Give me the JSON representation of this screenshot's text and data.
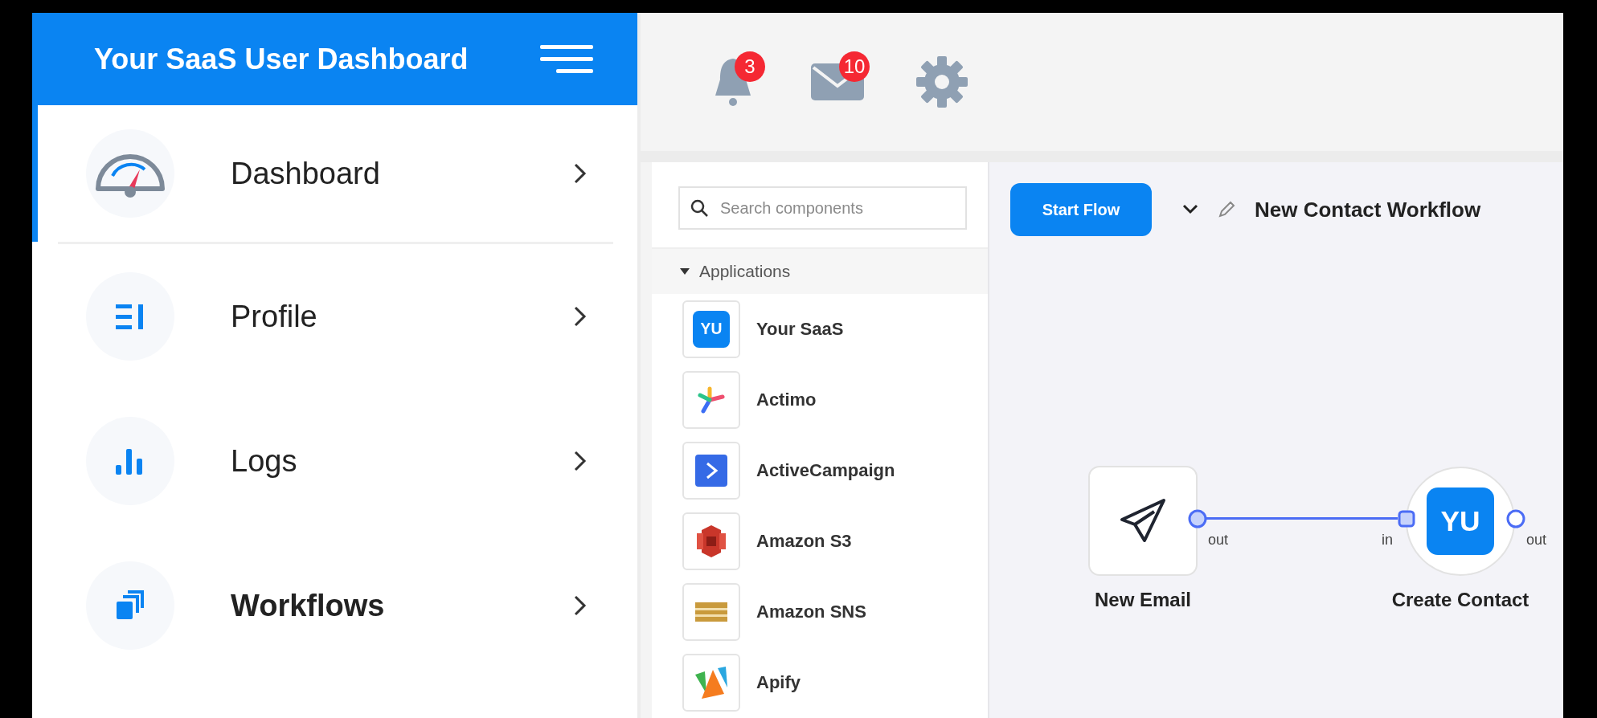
{
  "sidebar": {
    "title": "Your SaaS User Dashboard",
    "items": [
      {
        "label": "Dashboard",
        "kind": "gauge",
        "selected": true,
        "bold": false
      },
      {
        "label": "Profile",
        "kind": "list",
        "selected": false,
        "bold": false
      },
      {
        "label": "Logs",
        "kind": "bars",
        "selected": false,
        "bold": false
      },
      {
        "label": "Workflows",
        "kind": "stack",
        "selected": false,
        "bold": true
      }
    ]
  },
  "topbar": {
    "icons": [
      {
        "kind": "bell",
        "badge": "3"
      },
      {
        "kind": "mail",
        "badge": "10"
      },
      {
        "kind": "gear"
      }
    ]
  },
  "components": {
    "search": {
      "placeholder": "Search components"
    },
    "group": {
      "label": "Applications",
      "expanded": true
    },
    "items": [
      {
        "label": "Your SaaS",
        "kind": "yu",
        "logo_text": "YU"
      },
      {
        "label": "Actimo",
        "kind": "actimo"
      },
      {
        "label": "ActiveCampaign",
        "kind": "activecampaign"
      },
      {
        "label": "Amazon S3",
        "kind": "s3"
      },
      {
        "label": "Amazon SNS",
        "kind": "sns"
      },
      {
        "label": "Apify",
        "kind": "apify"
      }
    ]
  },
  "canvas": {
    "start_button": "Start Flow",
    "workflow_title": "New Contact Workflow",
    "nodes": [
      {
        "label": "New Email",
        "kind": "trigger",
        "out": "out"
      },
      {
        "label": "Create Contact",
        "kind": "action",
        "logo_text": "YU",
        "in": "in",
        "out": "out"
      }
    ]
  }
}
